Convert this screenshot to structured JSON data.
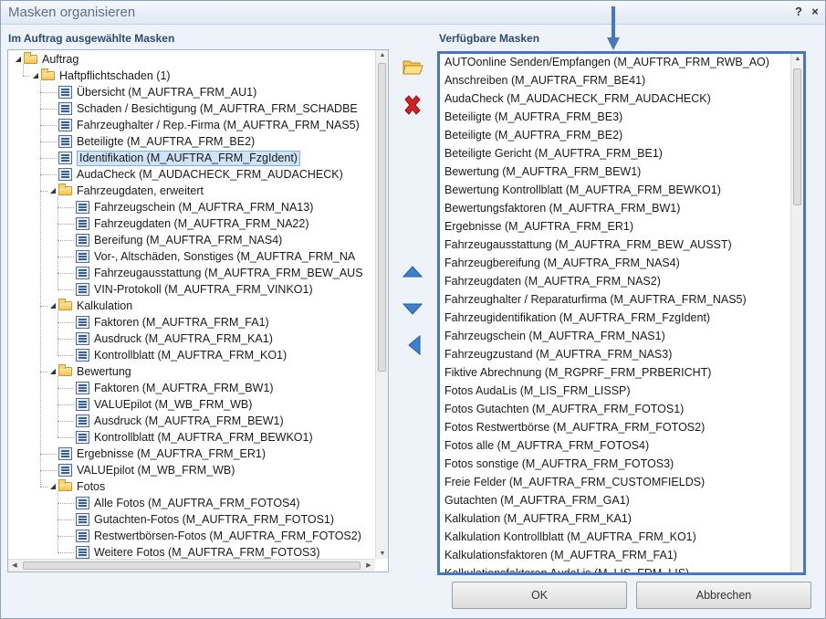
{
  "window": {
    "title": "Masken organisieren",
    "help_label": "?",
    "close_label": "×"
  },
  "left": {
    "heading": "Im Auftrag ausgewählte Masken",
    "tree": [
      {
        "label": "Auftrag",
        "level": 0,
        "type": "folder"
      },
      {
        "label": "Haftpflichtschaden (1)",
        "level": 1,
        "type": "folder"
      },
      {
        "label": "Übersicht (M_AUFTRA_FRM_AU1)",
        "level": 2,
        "type": "form"
      },
      {
        "label": "Schaden / Besichtigung (M_AUFTRA_FRM_SCHADBE",
        "level": 2,
        "type": "form"
      },
      {
        "label": "Fahrzeughalter / Rep.-Firma (M_AUFTRA_FRM_NAS5)",
        "level": 2,
        "type": "form"
      },
      {
        "label": "Beteiligte (M_AUFTRA_FRM_BE2)",
        "level": 2,
        "type": "form"
      },
      {
        "label": "Identifikation (M_AUFTRA_FRM_FzgIdent)",
        "level": 2,
        "type": "form",
        "selected": true
      },
      {
        "label": "AudaCheck (M_AUDACHECK_FRM_AUDACHECK)",
        "level": 2,
        "type": "form"
      },
      {
        "label": "Fahrzeugdaten, erweitert",
        "level": 2,
        "type": "folder"
      },
      {
        "label": "Fahrzeugschein (M_AUFTRA_FRM_NA13)",
        "level": 3,
        "type": "form"
      },
      {
        "label": "Fahrzeugdaten (M_AUFTRA_FRM_NA22)",
        "level": 3,
        "type": "form"
      },
      {
        "label": "Bereifung (M_AUFTRA_FRM_NAS4)",
        "level": 3,
        "type": "form"
      },
      {
        "label": "Vor-, Altschäden, Sonstiges (M_AUFTRA_FRM_NA",
        "level": 3,
        "type": "form"
      },
      {
        "label": "Fahrzeugausstattung (M_AUFTRA_FRM_BEW_AUS",
        "level": 3,
        "type": "form"
      },
      {
        "label": "VIN-Protokoll (M_AUFTRA_FRM_VINKO1)",
        "level": 3,
        "type": "form"
      },
      {
        "label": "Kalkulation",
        "level": 2,
        "type": "folder"
      },
      {
        "label": "Faktoren (M_AUFTRA_FRM_FA1)",
        "level": 3,
        "type": "form"
      },
      {
        "label": "Ausdruck (M_AUFTRA_FRM_KA1)",
        "level": 3,
        "type": "form"
      },
      {
        "label": "Kontrollblatt (M_AUFTRA_FRM_KO1)",
        "level": 3,
        "type": "form"
      },
      {
        "label": "Bewertung",
        "level": 2,
        "type": "folder"
      },
      {
        "label": "Faktoren (M_AUFTRA_FRM_BW1)",
        "level": 3,
        "type": "form"
      },
      {
        "label": "VALUEpilot (M_WB_FRM_WB)",
        "level": 3,
        "type": "form"
      },
      {
        "label": "Ausdruck (M_AUFTRA_FRM_BEW1)",
        "level": 3,
        "type": "form"
      },
      {
        "label": "Kontrollblatt (M_AUFTRA_FRM_BEWKO1)",
        "level": 3,
        "type": "form"
      },
      {
        "label": "Ergebnisse (M_AUFTRA_FRM_ER1)",
        "level": 2,
        "type": "form"
      },
      {
        "label": "VALUEpilot (M_WB_FRM_WB)",
        "level": 2,
        "type": "form"
      },
      {
        "label": "Fotos",
        "level": 2,
        "type": "folder"
      },
      {
        "label": "Alle Fotos (M_AUFTRA_FRM_FOTOS4)",
        "level": 3,
        "type": "form"
      },
      {
        "label": "Gutachten-Fotos (M_AUFTRA_FRM_FOTOS1)",
        "level": 3,
        "type": "form"
      },
      {
        "label": "Restwertbörsen-Fotos (M_AUFTRA_FRM_FOTOS2)",
        "level": 3,
        "type": "form"
      },
      {
        "label": "Weitere Fotos (M_AUFTRA_FRM_FOTOS3)",
        "level": 3,
        "type": "form"
      }
    ]
  },
  "right": {
    "heading": "Verfügbare Masken",
    "items": [
      "AUTOonline Senden/Empfangen (M_AUFTRA_FRM_RWB_AO)",
      "Anschreiben (M_AUFTRA_FRM_BE41)",
      "AudaCheck (M_AUDACHECK_FRM_AUDACHECK)",
      "Beteiligte (M_AUFTRA_FRM_BE3)",
      "Beteiligte (M_AUFTRA_FRM_BE2)",
      "Beteiligte Gericht (M_AUFTRA_FRM_BE1)",
      "Bewertung (M_AUFTRA_FRM_BEW1)",
      "Bewertung Kontrollblatt (M_AUFTRA_FRM_BEWKO1)",
      "Bewertungsfaktoren (M_AUFTRA_FRM_BW1)",
      "Ergebnisse (M_AUFTRA_FRM_ER1)",
      "Fahrzeugausstattung (M_AUFTRA_FRM_BEW_AUSST)",
      "Fahrzeugbereifung (M_AUFTRA_FRM_NAS4)",
      "Fahrzeugdaten (M_AUFTRA_FRM_NAS2)",
      "Fahrzeughalter / Reparaturfirma (M_AUFTRA_FRM_NAS5)",
      "Fahrzeugidentifikation (M_AUFTRA_FRM_FzgIdent)",
      "Fahrzeugschein (M_AUFTRA_FRM_NAS1)",
      "Fahrzeugzustand (M_AUFTRA_FRM_NAS3)",
      "Fiktive Abrechnung (M_RGPRF_FRM_PRBERICHT)",
      "Fotos AudaLis (M_LIS_FRM_LISSP)",
      "Fotos Gutachten (M_AUFTRA_FRM_FOTOS1)",
      "Fotos Restwertbörse (M_AUFTRA_FRM_FOTOS2)",
      "Fotos alle (M_AUFTRA_FRM_FOTOS4)",
      "Fotos sonstige (M_AUFTRA_FRM_FOTOS3)",
      "Freie Felder (M_AUFTRA_FRM_CUSTOMFIELDS)",
      "Gutachten (M_AUFTRA_FRM_GA1)",
      "Kalkulation (M_AUFTRA_FRM_KA1)",
      "Kalkulation Kontrollblatt (M_AUFTRA_FRM_KO1)",
      "Kalkulationsfaktoren (M_AUFTRA_FRM_FA1)",
      "Kalkulationsfaktoren AudaLis (M_LIS_FRM_LIS)"
    ]
  },
  "buttons": {
    "ok": "OK",
    "cancel": "Abbrechen"
  },
  "colors": {
    "highlight_border": "#4a76c0",
    "heading": "#2d4a73",
    "remove_icon": "#d62020",
    "move_arrow": "#3f7fcf"
  }
}
